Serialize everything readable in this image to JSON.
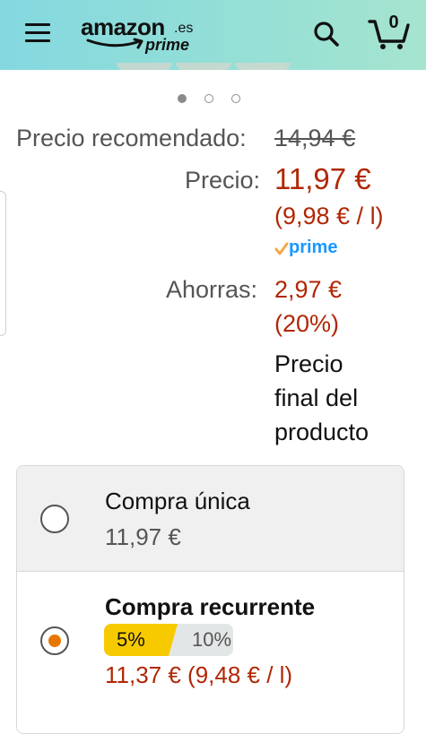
{
  "header": {
    "logo_word": "amazon",
    "logo_tld": ".es",
    "logo_sub": "prime",
    "cart_count": "0"
  },
  "carousel": {
    "pages": 3,
    "active_index": 0
  },
  "price": {
    "recommended_label": "Precio recomendado:",
    "recommended_value": "14,94 €",
    "price_label": "Precio:",
    "price_value": "11,97 €",
    "unit_price": "(9,98 € / l)",
    "prime_text": "prime",
    "savings_label": "Ahorras:",
    "savings_value": "2,97 €",
    "savings_percent": "(20%)",
    "final_note_line1": "Precio",
    "final_note_line2": "final del",
    "final_note_line3": "producto"
  },
  "purchase_options": {
    "one_time": {
      "title": "Compra única",
      "price": "11,97 €",
      "selected": false
    },
    "subscribe": {
      "title": "Compra recurrente",
      "discount_tier_1": "5%",
      "discount_tier_2": "10%",
      "price": "11,37 € (9,48 € / l)",
      "selected": true
    }
  },
  "colors": {
    "header_gradient_start": "#84d8e0",
    "header_gradient_end": "#a6e4cf",
    "price_red": "#b12704",
    "radio_orange": "#e77600",
    "discount_yellow": "#f7ca00",
    "prime_blue": "#1a98ff"
  },
  "icons": [
    "menu-icon",
    "search-icon",
    "cart-icon",
    "prime-check-icon",
    "radio-icon"
  ]
}
